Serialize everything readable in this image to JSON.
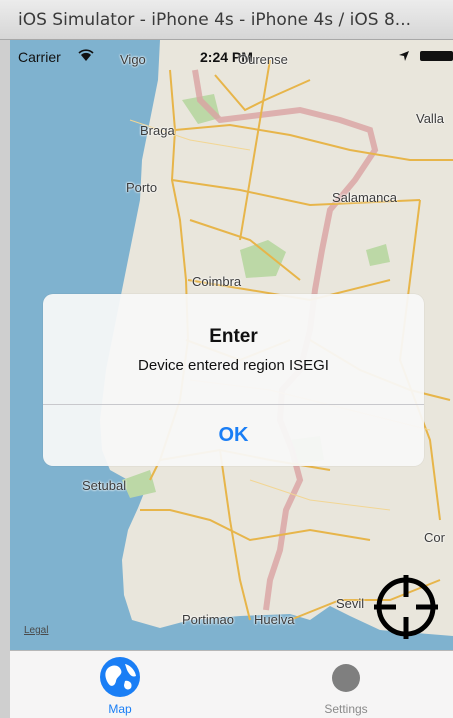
{
  "window": {
    "title": "iOS Simulator - iPhone 4s - iPhone 4s / iOS 8..."
  },
  "status_bar": {
    "carrier": "Carrier",
    "time": "2:24 PM"
  },
  "map": {
    "labels": {
      "vigo": "Vigo",
      "ourense": "Ourense",
      "braga": "Braga",
      "porto": "Porto",
      "salamanca": "Salamanca",
      "valladolid": "Valla",
      "coimbra": "Coimbra",
      "setubal": "Setubal",
      "cordoba": "Cor",
      "sevilla": "Sevil",
      "portimao": "Portimao",
      "huelva": "Huelva"
    },
    "legal": "Legal",
    "colors": {
      "ocean": "#7fb2cf",
      "land": "#e9e6dc",
      "roads": "#e7b54a",
      "border": "#d9a2a2",
      "parks": "#bcd8a6"
    }
  },
  "alert": {
    "title": "Enter",
    "message": "Device entered region ISEGI",
    "ok_label": "OK"
  },
  "tab_bar": {
    "items": [
      {
        "label": "Map",
        "icon": "globe-icon",
        "selected": true
      },
      {
        "label": "Settings",
        "icon": "circle-icon",
        "selected": false
      }
    ]
  }
}
